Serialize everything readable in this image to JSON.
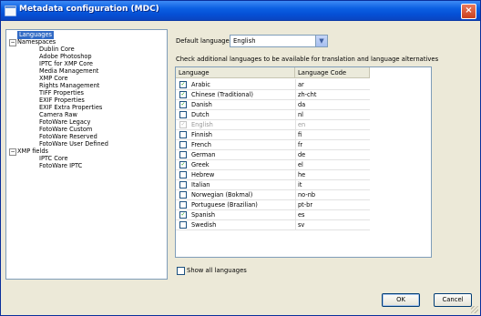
{
  "window": {
    "title": "Metadata configuration (MDC)",
    "close_glyph": "×"
  },
  "tree": {
    "items": [
      {
        "label": "Languages",
        "indent": 0,
        "selected": true
      },
      {
        "label": "Namespaces",
        "indent": 0,
        "expander": "−"
      },
      {
        "label": "Dublin Core",
        "indent": 1
      },
      {
        "label": "Adobe Photoshop",
        "indent": 1
      },
      {
        "label": "IPTC for XMP Core",
        "indent": 1
      },
      {
        "label": "Media Management",
        "indent": 1
      },
      {
        "label": "XMP Core",
        "indent": 1
      },
      {
        "label": "Rights Management",
        "indent": 1
      },
      {
        "label": "TIFF Properties",
        "indent": 1
      },
      {
        "label": "EXIF Properties",
        "indent": 1
      },
      {
        "label": "EXIF Extra Properties",
        "indent": 1
      },
      {
        "label": "Camera Raw",
        "indent": 1
      },
      {
        "label": "FotoWare Legacy",
        "indent": 1
      },
      {
        "label": "FotoWare Custom",
        "indent": 1
      },
      {
        "label": "FotoWare Reserved",
        "indent": 1
      },
      {
        "label": "FotoWare User Defined",
        "indent": 1
      },
      {
        "label": "XMP fields",
        "indent": 0,
        "expander": "−"
      },
      {
        "label": "IPTC Core",
        "indent": 1
      },
      {
        "label": "FotoWare IPTC",
        "indent": 1
      }
    ]
  },
  "main": {
    "default_language_label": "Default language:",
    "default_language_value": "English",
    "dropdown_arrow": "▼",
    "instructions": "Check additional languages to be available for translation and language alternatives",
    "table": {
      "headers": {
        "language": "Language",
        "code": "Language Code"
      },
      "check_glyph": "✓",
      "rows": [
        {
          "language": "Arabic",
          "code": "ar",
          "checked": true,
          "disabled": false
        },
        {
          "language": "Chinese (Traditional)",
          "code": "zh-cht",
          "checked": true,
          "disabled": false
        },
        {
          "language": "Danish",
          "code": "da",
          "checked": true,
          "disabled": false
        },
        {
          "language": "Dutch",
          "code": "nl",
          "checked": false,
          "disabled": false
        },
        {
          "language": "English",
          "code": "en",
          "checked": true,
          "disabled": true
        },
        {
          "language": "Finnish",
          "code": "fi",
          "checked": false,
          "disabled": false
        },
        {
          "language": "French",
          "code": "fr",
          "checked": false,
          "disabled": false
        },
        {
          "language": "German",
          "code": "de",
          "checked": false,
          "disabled": false
        },
        {
          "language": "Greek",
          "code": "el",
          "checked": true,
          "disabled": false
        },
        {
          "language": "Hebrew",
          "code": "he",
          "checked": false,
          "disabled": false
        },
        {
          "language": "Italian",
          "code": "it",
          "checked": false,
          "disabled": false
        },
        {
          "language": "Norwegian (Bokmal)",
          "code": "no-nb",
          "checked": false,
          "disabled": false
        },
        {
          "language": "Portuguese (Brazilian)",
          "code": "pt-br",
          "checked": false,
          "disabled": false
        },
        {
          "language": "Spanish",
          "code": "es",
          "checked": true,
          "disabled": false
        },
        {
          "language": "Swedish",
          "code": "sv",
          "checked": false,
          "disabled": false
        }
      ]
    },
    "show_all_label": "Show all languages",
    "show_all_checked": false
  },
  "buttons": {
    "ok": "OK",
    "cancel": "Cancel"
  },
  "colors": {
    "titlebar": "#0550d6",
    "selection": "#316ac5",
    "dialog_bg": "#ece9d8",
    "check": "#21a121"
  }
}
